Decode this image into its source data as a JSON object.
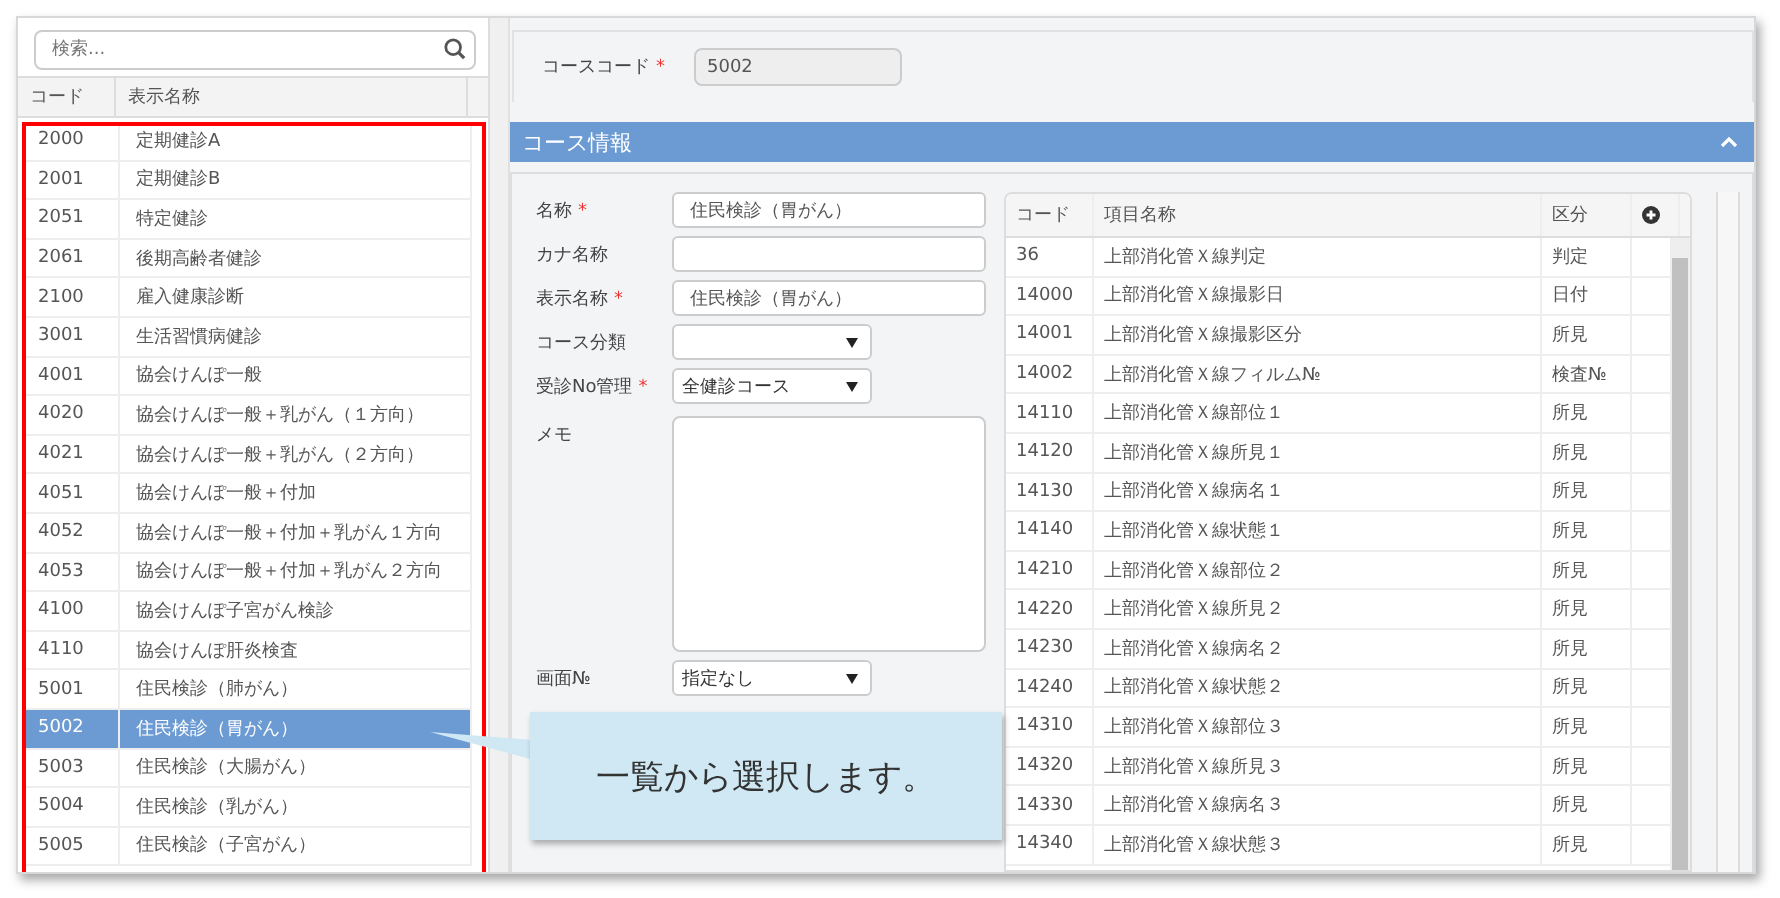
{
  "search": {
    "placeholder": "検索..."
  },
  "course_list": {
    "columns": [
      "コード",
      "表示名称"
    ],
    "rows": [
      {
        "code": "2000",
        "name": "定期健診A",
        "selected": false
      },
      {
        "code": "2001",
        "name": "定期健診B",
        "selected": false
      },
      {
        "code": "2051",
        "name": "特定健診",
        "selected": false
      },
      {
        "code": "2061",
        "name": "後期高齢者健診",
        "selected": false
      },
      {
        "code": "2100",
        "name": "雇入健康診断",
        "selected": false
      },
      {
        "code": "3001",
        "name": "生活習慣病健診",
        "selected": false
      },
      {
        "code": "4001",
        "name": "協会けんぽ一般",
        "selected": false
      },
      {
        "code": "4020",
        "name": "協会けんぽ一般＋乳がん（１方向）",
        "selected": false
      },
      {
        "code": "4021",
        "name": "協会けんぽ一般＋乳がん（２方向）",
        "selected": false
      },
      {
        "code": "4051",
        "name": "協会けんぽ一般＋付加",
        "selected": false
      },
      {
        "code": "4052",
        "name": "協会けんぽ一般＋付加＋乳がん１方向",
        "selected": false
      },
      {
        "code": "4053",
        "name": "協会けんぽ一般＋付加＋乳がん２方向",
        "selected": false
      },
      {
        "code": "4100",
        "name": "協会けんぽ子宮がん検診",
        "selected": false
      },
      {
        "code": "4110",
        "name": "協会けんぽ肝炎検査",
        "selected": false
      },
      {
        "code": "5001",
        "name": "住民検診（肺がん）",
        "selected": false
      },
      {
        "code": "5002",
        "name": "住民検診（胃がん）",
        "selected": true
      },
      {
        "code": "5003",
        "name": "住民検診（大腸がん）",
        "selected": false
      },
      {
        "code": "5004",
        "name": "住民検診（乳がん）",
        "selected": false
      },
      {
        "code": "5005",
        "name": "住民検診（子宮がん）",
        "selected": false
      }
    ]
  },
  "required_mark": "*",
  "course_code": {
    "label": "コースコード",
    "required": true,
    "value": "5002"
  },
  "section": {
    "title": "コース情報",
    "expanded": true
  },
  "form": {
    "fields": [
      {
        "kind": "text",
        "label": "名称",
        "required": true,
        "value": "住民検診（胃がん）"
      },
      {
        "kind": "text",
        "label": "カナ名称",
        "required": false
      },
      {
        "kind": "text",
        "label": "表示名称",
        "required": true,
        "value": "住民検診（胃がん）"
      },
      {
        "kind": "select",
        "label": "コース分類",
        "required": false
      },
      {
        "kind": "select",
        "label": "受診No管理",
        "required": true,
        "value": "全健診コース"
      },
      {
        "kind": "textarea",
        "label": "メモ",
        "required": false
      },
      {
        "kind": "select",
        "label": "画面№",
        "required": false,
        "value": "指定なし"
      }
    ]
  },
  "items_table": {
    "columns": [
      "コード",
      "項目名称",
      "区分"
    ],
    "rows": [
      {
        "code": "36",
        "name": "上部消化管Ｘ線判定",
        "category": "判定"
      },
      {
        "code": "14000",
        "name": "上部消化管Ｘ線撮影日",
        "category": "日付"
      },
      {
        "code": "14001",
        "name": "上部消化管Ｘ線撮影区分",
        "category": "所見"
      },
      {
        "code": "14002",
        "name": "上部消化管Ｘ線フィルム№",
        "category": "検査№"
      },
      {
        "code": "14110",
        "name": "上部消化管Ｘ線部位１",
        "category": "所見"
      },
      {
        "code": "14120",
        "name": "上部消化管Ｘ線所見１",
        "category": "所見"
      },
      {
        "code": "14130",
        "name": "上部消化管Ｘ線病名１",
        "category": "所見"
      },
      {
        "code": "14140",
        "name": "上部消化管Ｘ線状態１",
        "category": "所見"
      },
      {
        "code": "14210",
        "name": "上部消化管Ｘ線部位２",
        "category": "所見"
      },
      {
        "code": "14220",
        "name": "上部消化管Ｘ線所見２",
        "category": "所見"
      },
      {
        "code": "14230",
        "name": "上部消化管Ｘ線病名２",
        "category": "所見"
      },
      {
        "code": "14240",
        "name": "上部消化管Ｘ線状態２",
        "category": "所見"
      },
      {
        "code": "14310",
        "name": "上部消化管Ｘ線部位３",
        "category": "所見"
      },
      {
        "code": "14320",
        "name": "上部消化管Ｘ線所見３",
        "category": "所見"
      },
      {
        "code": "14330",
        "name": "上部消化管Ｘ線病名３",
        "category": "所見"
      },
      {
        "code": "14340",
        "name": "上部消化管Ｘ線状態３",
        "category": "所見"
      }
    ]
  },
  "callout": {
    "text": "一覧から選択します。"
  }
}
